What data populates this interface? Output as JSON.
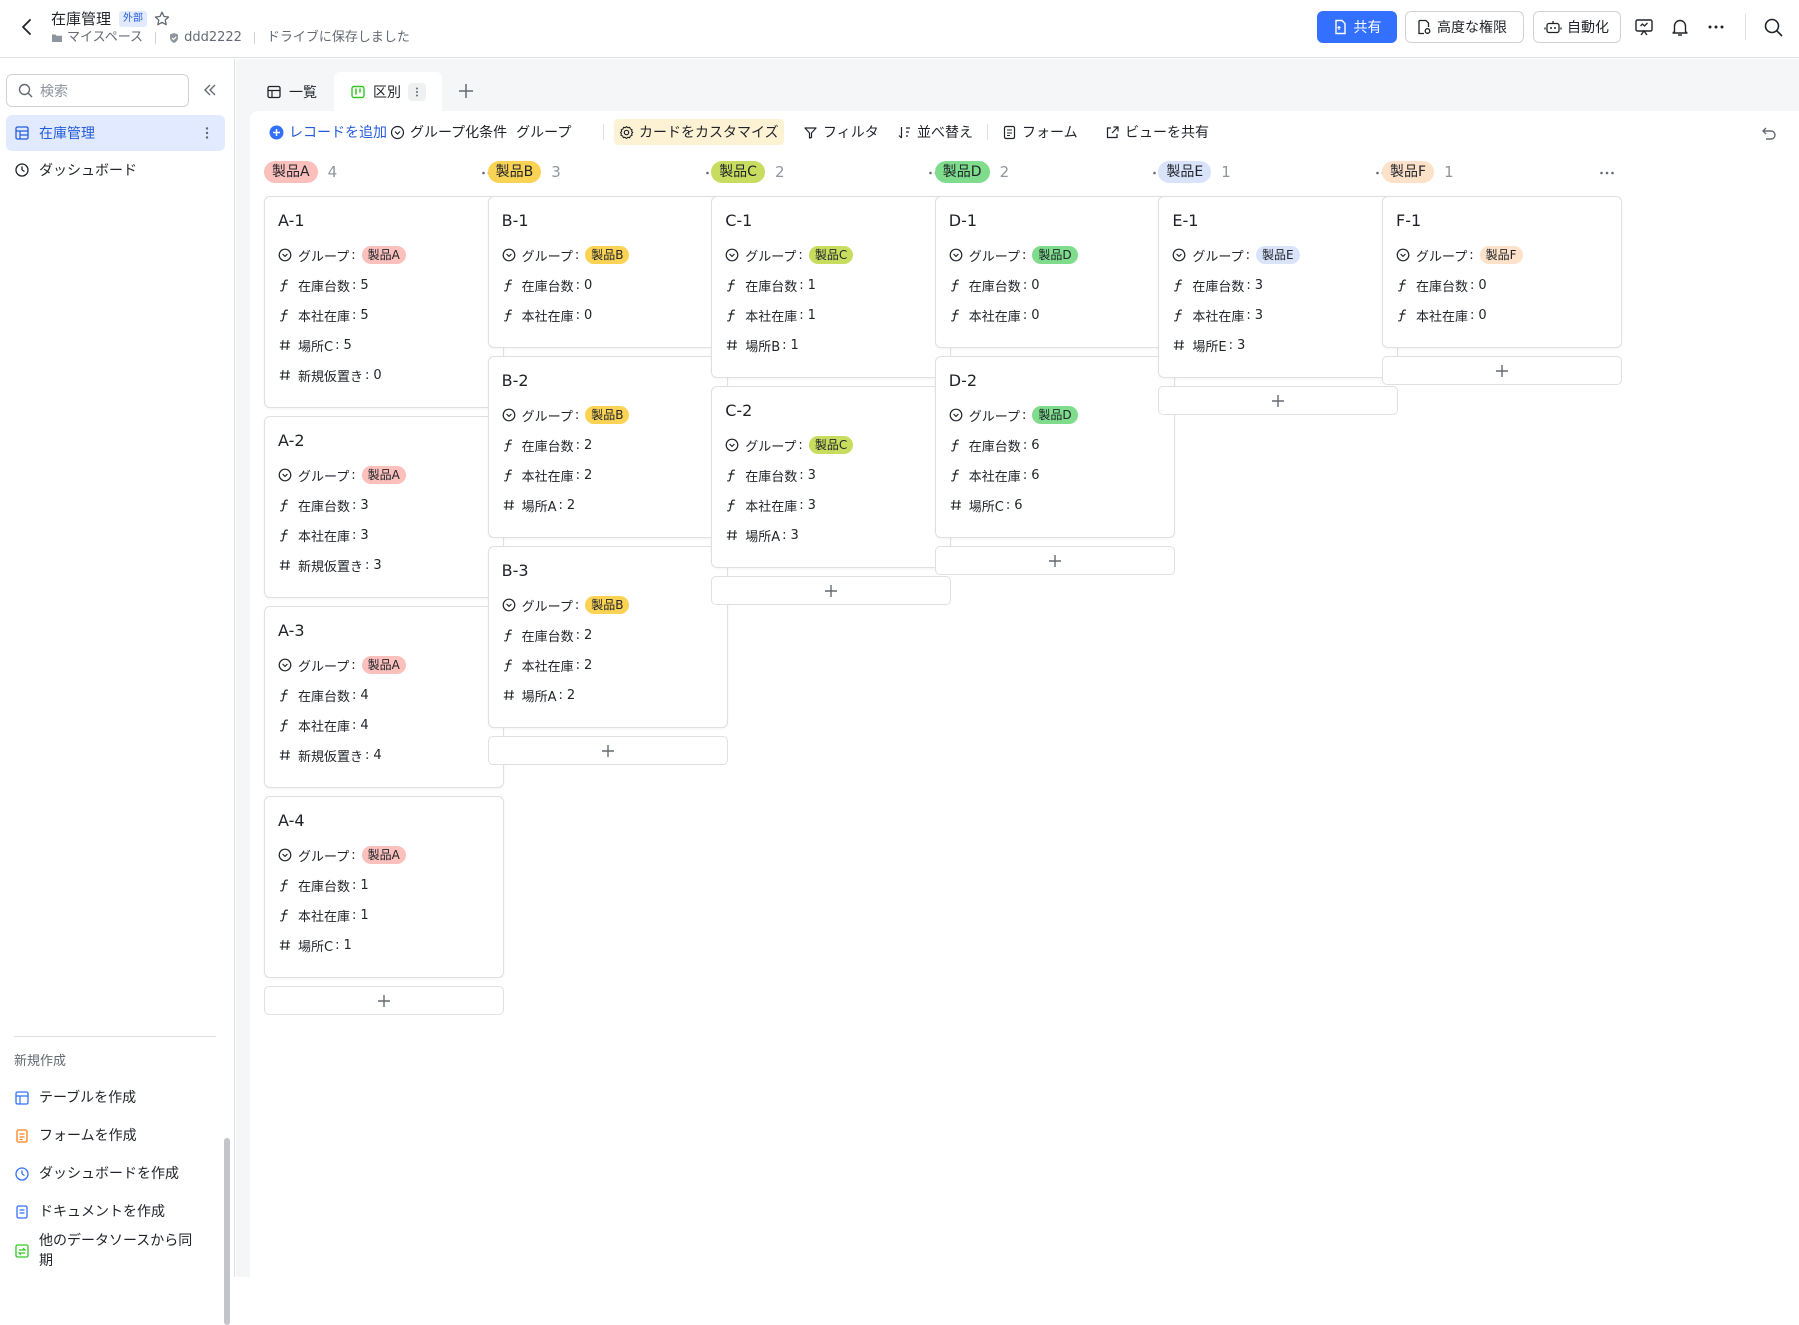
{
  "header": {
    "title": "在庫管理",
    "external_badge": "外部",
    "breadcrumb_space": "マイスペース",
    "breadcrumb_owner": "ddd2222",
    "saved_status": "ドライブに保存しました",
    "share_label": "共有",
    "permissions_label": "高度な権限",
    "automation_label": "自動化"
  },
  "sidebar": {
    "search_placeholder": "検索",
    "items": [
      {
        "label": "在庫管理"
      },
      {
        "label": "ダッシュボード"
      }
    ],
    "create_heading": "新規作成",
    "create_items": [
      {
        "label": "テーブルを作成"
      },
      {
        "label": "フォームを作成"
      },
      {
        "label": "ダッシュボードを作成"
      },
      {
        "label": "ドキュメントを作成"
      },
      {
        "label": "他のデータソースから同期"
      }
    ]
  },
  "tabs": [
    {
      "label": "一覧"
    },
    {
      "label": "区別"
    }
  ],
  "toolbar": {
    "add_record": "レコードを追加",
    "group_condition": "グループ化条件",
    "group_value": "グループ",
    "customize_card": "カードをカスタマイズ",
    "filter": "フィルタ",
    "sort": "並べ替え",
    "form": "フォーム",
    "share_view": "ビューを共有"
  },
  "colors": {
    "accent": "#3370ff",
    "tag_a": "#fbbfbc",
    "tag_b": "#fad355",
    "tag_c": "#c8dd5f",
    "tag_d": "#7edc8c",
    "tag_e": "#d9e4fb",
    "tag_f": "#fde2c9"
  },
  "board": {
    "field_group": "グループ",
    "field_stock": "在庫台数",
    "field_hq": "本社在庫",
    "columns": [
      {
        "label": "製品A",
        "count": "4",
        "cards": [
          {
            "title": "A-1",
            "stock": "5",
            "hq": "5",
            "extra": [
              {
                "label": "場所C",
                "value": "5"
              },
              {
                "label": "新規仮置き",
                "value": "0"
              }
            ]
          },
          {
            "title": "A-2",
            "stock": "3",
            "hq": "3",
            "extra": [
              {
                "label": "新規仮置き",
                "value": "3"
              }
            ]
          },
          {
            "title": "A-3",
            "stock": "4",
            "hq": "4",
            "extra": [
              {
                "label": "新規仮置き",
                "value": "4"
              }
            ]
          },
          {
            "title": "A-4",
            "stock": "1",
            "hq": "1",
            "extra": [
              {
                "label": "場所C",
                "value": "1"
              }
            ]
          }
        ]
      },
      {
        "label": "製品B",
        "count": "3",
        "cards": [
          {
            "title": "B-1",
            "stock": "0",
            "hq": "0",
            "extra": []
          },
          {
            "title": "B-2",
            "stock": "2",
            "hq": "2",
            "extra": [
              {
                "label": "場所A",
                "value": "2"
              }
            ]
          },
          {
            "title": "B-3",
            "stock": "2",
            "hq": "2",
            "extra": [
              {
                "label": "場所A",
                "value": "2"
              }
            ]
          }
        ]
      },
      {
        "label": "製品C",
        "count": "2",
        "cards": [
          {
            "title": "C-1",
            "stock": "1",
            "hq": "1",
            "extra": [
              {
                "label": "場所B",
                "value": "1"
              }
            ]
          },
          {
            "title": "C-2",
            "stock": "3",
            "hq": "3",
            "extra": [
              {
                "label": "場所A",
                "value": "3"
              }
            ]
          }
        ]
      },
      {
        "label": "製品D",
        "count": "2",
        "cards": [
          {
            "title": "D-1",
            "stock": "0",
            "hq": "0",
            "extra": []
          },
          {
            "title": "D-2",
            "stock": "6",
            "hq": "6",
            "extra": [
              {
                "label": "場所C",
                "value": "6"
              }
            ]
          }
        ]
      },
      {
        "label": "製品E",
        "count": "1",
        "cards": [
          {
            "title": "E-1",
            "stock": "3",
            "hq": "3",
            "extra": [
              {
                "label": "場所E",
                "value": "3"
              }
            ]
          }
        ]
      },
      {
        "label": "製品F",
        "count": "1",
        "cards": [
          {
            "title": "F-1",
            "stock": "0",
            "hq": "0",
            "extra": []
          }
        ]
      }
    ]
  }
}
